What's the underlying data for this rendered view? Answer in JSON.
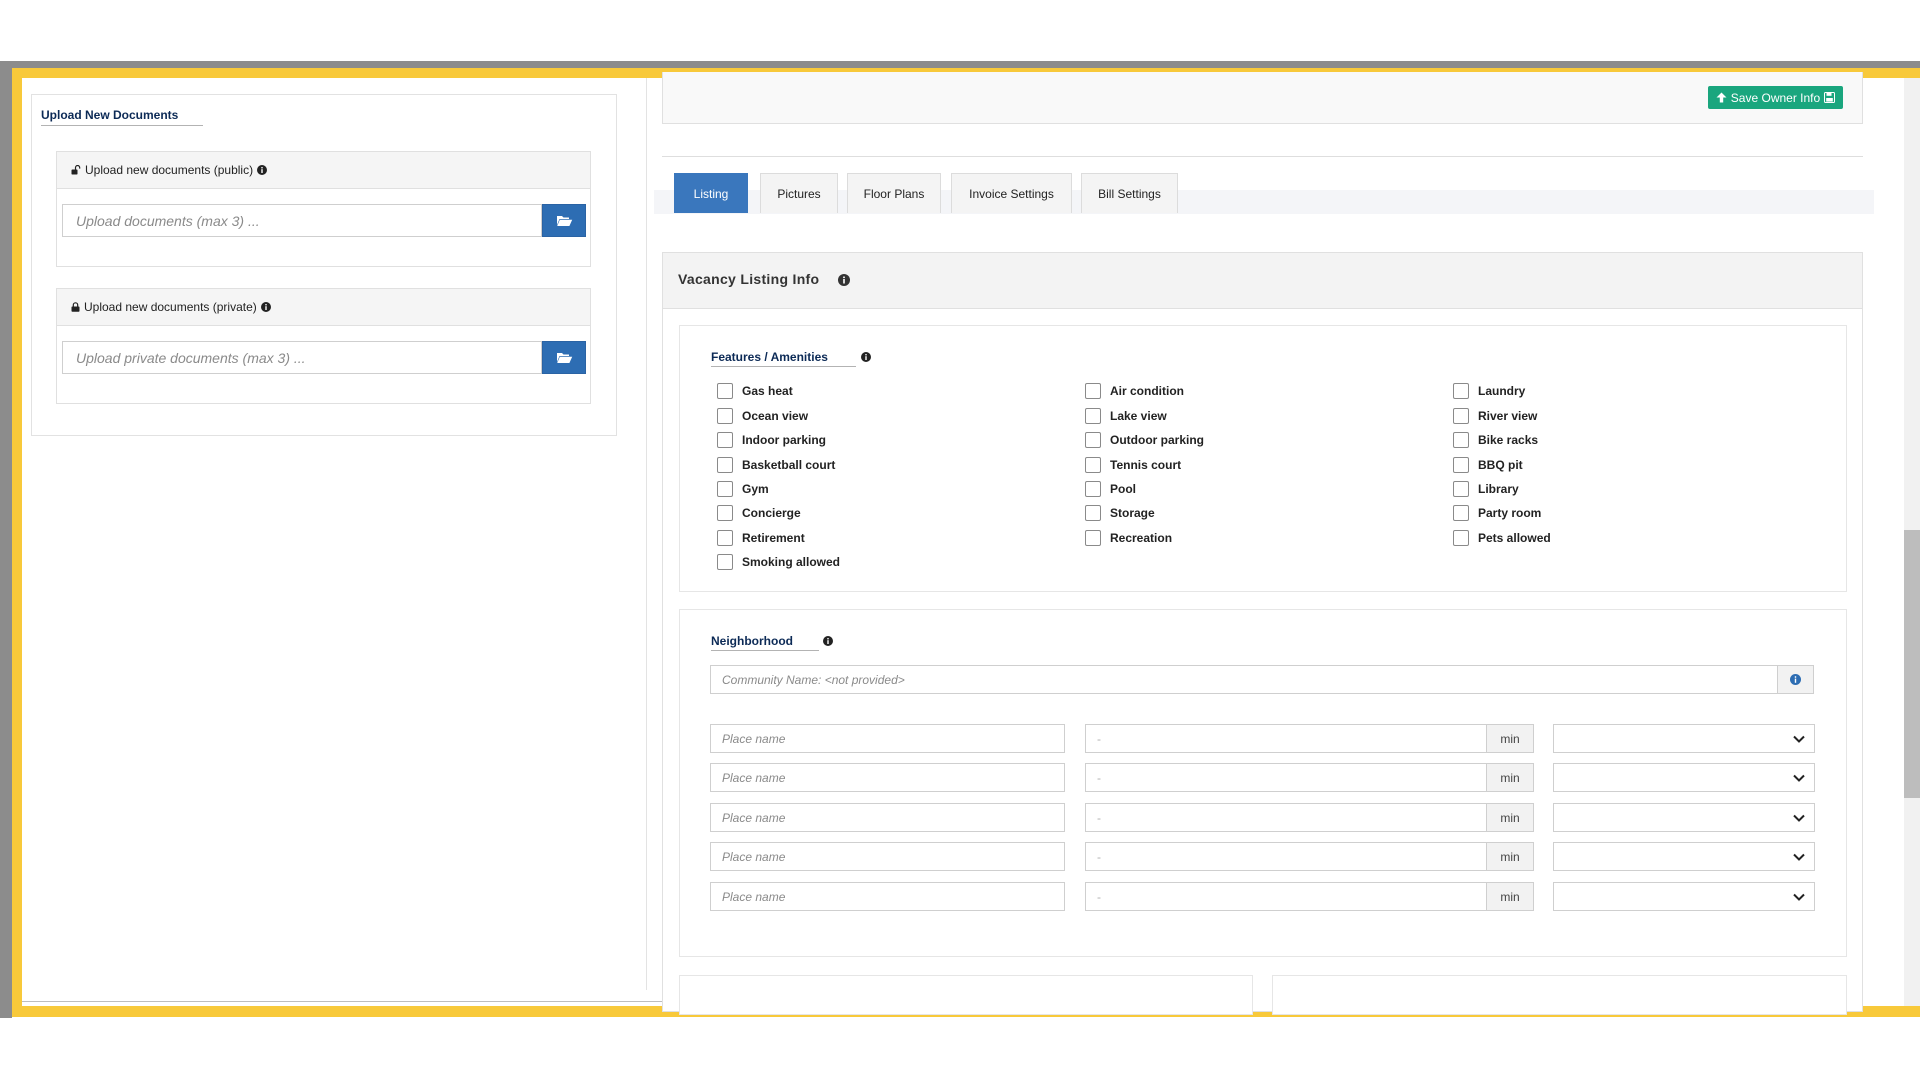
{
  "upload": {
    "title": "Upload New Documents",
    "public": {
      "label": "Upload new documents (public)",
      "placeholder": "Upload documents (max 3) ..."
    },
    "private": {
      "label": "Upload new documents (private)",
      "placeholder": "Upload private documents (max 3) ..."
    }
  },
  "toolbar": {
    "save_label": "Save Owner Info"
  },
  "tabs": [
    {
      "label": "Listing",
      "active": true
    },
    {
      "label": "Pictures",
      "active": false
    },
    {
      "label": "Floor Plans",
      "active": false
    },
    {
      "label": "Invoice Settings",
      "active": false
    },
    {
      "label": "Bill Settings",
      "active": false
    }
  ],
  "vacancy": {
    "title": "Vacancy Listing Info"
  },
  "features": {
    "title": "Features / Amenities",
    "col1": [
      "Gas heat",
      "Ocean view",
      "Indoor parking",
      "Basketball court",
      "Gym",
      "Concierge",
      "Retirement",
      "Smoking allowed"
    ],
    "col2": [
      "Air condition",
      "Lake view",
      "Outdoor parking",
      "Tennis court",
      "Pool",
      "Storage",
      "Recreation"
    ],
    "col3": [
      "Laundry",
      "River view",
      "Bike racks",
      "BBQ pit",
      "Library",
      "Party room",
      "Pets allowed"
    ]
  },
  "neighborhood": {
    "title": "Neighborhood",
    "community_placeholder": "Community Name: <not provided>",
    "place_placeholder": "Place name",
    "distance_placeholder": "-",
    "unit": "min",
    "row_count": 5
  },
  "colors": {
    "frame": "#f8c93a",
    "primary": "#3a77bd",
    "success": "#1aa67e",
    "label": "#0c2a56"
  }
}
